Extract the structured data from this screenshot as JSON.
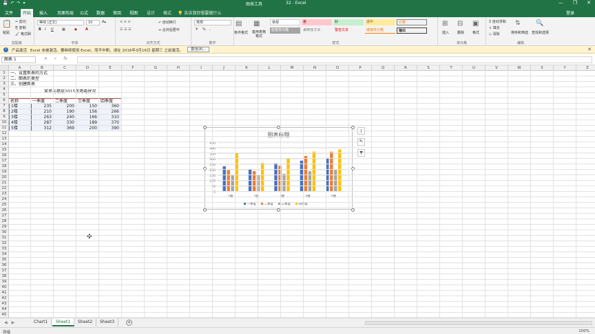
{
  "titlebar": {
    "context_tab_title": "图表工具",
    "window_title": "32 - Excel",
    "qat": [
      "💾",
      "↶",
      "↷",
      "▾"
    ],
    "window_buttons": [
      "—",
      "❐",
      "✕"
    ]
  },
  "tabs": [
    {
      "label": "文件"
    },
    {
      "label": "开始"
    },
    {
      "label": "插入"
    },
    {
      "label": "页面布局"
    },
    {
      "label": "公式"
    },
    {
      "label": "数据"
    },
    {
      "label": "审阅"
    },
    {
      "label": "视图"
    },
    {
      "label": "设计"
    },
    {
      "label": "格式"
    }
  ],
  "tellme": "告诉我你想要做什么",
  "signin": "登录",
  "ribbon": {
    "clipboard": {
      "label": "剪贴板",
      "paste": "粘贴",
      "cut": "剪切",
      "copy": "复制",
      "painter": "格式刷"
    },
    "font": {
      "label": "字体",
      "name": "等线 (正文)",
      "size": "10",
      "bold": "B",
      "italic": "I",
      "underline": "U"
    },
    "alignment": {
      "label": "对齐方式",
      "wrap": "自动换行",
      "merge": "合并后居中"
    },
    "number": {
      "label": "数字",
      "format": "常规",
      "percent": "%",
      "comma": ","
    },
    "styles": {
      "label": "样式",
      "cond": "条件格式",
      "table": "套用表格格式",
      "cells": [
        "常规",
        "差",
        "好",
        "适中",
        "计算",
        "检查单元格",
        "解释性文本",
        "警告文本",
        "链接单元格",
        "输出",
        "输入",
        "注释"
      ]
    },
    "cells": {
      "label": "单元格",
      "insert": "插入",
      "delete": "删除",
      "format": "格式"
    },
    "editing": {
      "label": "编辑",
      "autosum": "自动求和",
      "fill": "填充",
      "clear": "清除",
      "sort": "排序和筛选",
      "find": "查找和选择"
    }
  },
  "notification": {
    "title": "产品激活",
    "message": "Excel 未被激活。要继续使用 Excel，而不中断，请在 2016年3月16日 星期三 之前激活。",
    "button": "激活(A)...",
    "close": "✕"
  },
  "formula_bar": {
    "name_box": "图表 1",
    "cancel": "✕",
    "enter": "✓",
    "fx": "fx",
    "value": ""
  },
  "columns": [
    "A",
    "B",
    "C",
    "D",
    "E",
    "F",
    "G",
    "H",
    "I",
    "J",
    "K",
    "L",
    "M",
    "N",
    "O",
    "P",
    "Q",
    "R",
    "S",
    "T",
    "U",
    "V",
    "W",
    "X",
    "Y",
    "Z"
  ],
  "rows": [
    "1",
    "2",
    "3",
    "4",
    "5",
    "6",
    "7",
    "8",
    "9",
    "10",
    "11",
    "12",
    "13",
    "14",
    "15",
    "16",
    "17",
    "18",
    "19",
    "20",
    "21",
    "22",
    "23",
    "24",
    "25",
    "26",
    "27",
    "28",
    "29",
    "30",
    "31",
    "32",
    "33",
    "34",
    "35",
    "36",
    "37",
    "38",
    "39",
    "40",
    "41",
    "42",
    "43",
    "44",
    "45"
  ],
  "sheet": {
    "notes": [
      "一、设置图表的方式",
      "二、图表的类型",
      "三、创建图表"
    ],
    "table_title": "某单元楼层2015年用电状况",
    "headers": [
      "名称",
      "一季度",
      "二季度",
      "三季度",
      "四季度"
    ],
    "data": [
      {
        "name": "1楼",
        "values": [
          "235",
          "200",
          "150",
          "360"
        ]
      },
      {
        "name": "2楼",
        "values": [
          "210",
          "190",
          "156",
          "266"
        ]
      },
      {
        "name": "3楼",
        "values": [
          "263",
          "240",
          "166",
          "310"
        ]
      },
      {
        "name": "4楼",
        "values": [
          "287",
          "330",
          "189",
          "370"
        ]
      },
      {
        "name": "5楼",
        "values": [
          "312",
          "369",
          "200",
          "390"
        ]
      }
    ]
  },
  "chart_data": {
    "type": "bar",
    "title": "图表标题",
    "categories": [
      "1楼",
      "2楼",
      "3楼",
      "4楼",
      "5楼"
    ],
    "series": [
      {
        "name": "一季度",
        "color": "#4472c4",
        "values": [
          235,
          210,
          263,
          287,
          312
        ]
      },
      {
        "name": "二季度",
        "color": "#ed7d31",
        "values": [
          200,
          190,
          240,
          330,
          369
        ]
      },
      {
        "name": "三季度",
        "color": "#a5a5a5",
        "values": [
          150,
          156,
          166,
          189,
          200
        ]
      },
      {
        "name": "四季度",
        "color": "#ffc000",
        "values": [
          360,
          266,
          310,
          370,
          390
        ]
      }
    ],
    "ylim": [
      0,
      450
    ],
    "yticks": [
      0,
      50,
      100,
      150,
      200,
      250,
      300,
      350,
      400,
      450
    ],
    "grid": true,
    "legend": "bottom"
  },
  "chart_side_buttons": [
    "+",
    "✎",
    "▼"
  ],
  "sheet_tabs": [
    {
      "label": "Chart1",
      "active": false
    },
    {
      "label": "Sheet1",
      "active": true
    },
    {
      "label": "Sheet2",
      "active": false
    },
    {
      "label": "Sheet3",
      "active": false
    }
  ],
  "add_sheet": "+",
  "status": {
    "ready": "就绪",
    "zoom": "100%"
  },
  "colors": {
    "excel_green": "#217346",
    "notify_bg": "#fff4ce",
    "table_border": "#c0504d"
  }
}
